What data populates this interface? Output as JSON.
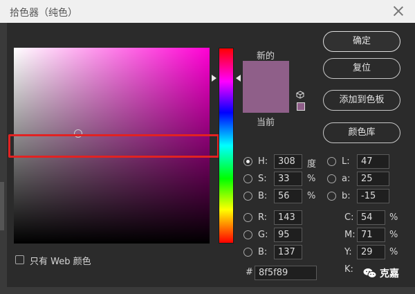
{
  "window": {
    "title": "拾色器（纯色）"
  },
  "labels": {
    "new": "新的",
    "current": "当前"
  },
  "buttons": {
    "ok": "确定",
    "reset": "复位",
    "add_to_swatches": "添加到色板",
    "color_library": "颜色库"
  },
  "hsb": {
    "h_label": "H:",
    "h_value": "308",
    "h_unit": "度",
    "s_label": "S:",
    "s_value": "33",
    "s_unit": "%",
    "b_label": "B:",
    "b_value": "56",
    "b_unit": "%"
  },
  "lab": {
    "l_label": "L:",
    "l_value": "47",
    "a_label": "a:",
    "a_value": "25",
    "b_label": "b:",
    "b_value": "-15"
  },
  "rgb": {
    "r_label": "R:",
    "r_value": "143",
    "g_label": "G:",
    "g_value": "95",
    "b_label": "B:",
    "b_value": "137"
  },
  "cmyk": {
    "c_label": "C:",
    "c_value": "54",
    "c_unit": "%",
    "m_label": "M:",
    "m_value": "71",
    "m_unit": "%",
    "y_label": "Y:",
    "y_value": "29",
    "y_unit": "%",
    "k_label": "K:"
  },
  "hex": {
    "hash": "#",
    "value": "8f5f89"
  },
  "web_only": {
    "label": "只有 Web 颜色"
  },
  "watermark": {
    "text": "克嘉"
  },
  "colors": {
    "new_color": "#8f5f89",
    "current_color": "#8f5f89",
    "highlight": "#e22222"
  }
}
